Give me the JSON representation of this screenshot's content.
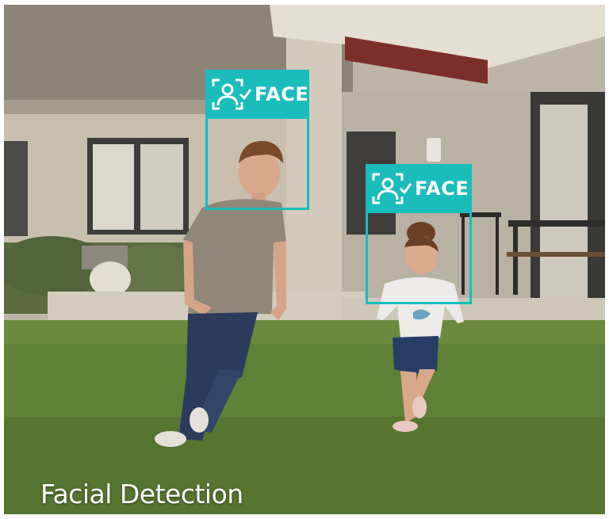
{
  "overlay": {
    "accent_color": "#1bbcbc",
    "detections": [
      {
        "label": "FACE",
        "icon": "face-scan-icon"
      },
      {
        "label": "FACE",
        "icon": "face-scan-icon"
      }
    ]
  },
  "caption": "Facial Detection"
}
